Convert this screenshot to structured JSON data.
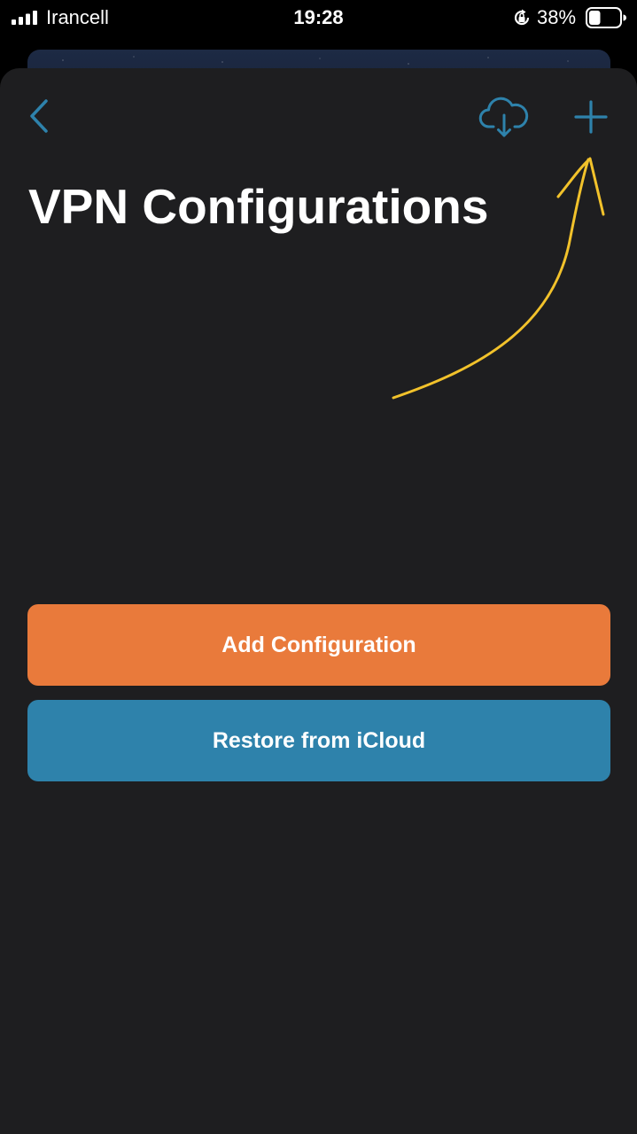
{
  "status_bar": {
    "carrier": "Irancell",
    "time": "19:28",
    "battery_percent": "38%",
    "signal_bars": 4,
    "battery_level": 0.38
  },
  "nav": {
    "back_icon": "chevron-left-icon",
    "cloud_icon": "cloud-download-icon",
    "add_icon": "plus-icon"
  },
  "page": {
    "title": "VPN Configurations"
  },
  "actions": {
    "add_label": "Add Configuration",
    "restore_label": "Restore from iCloud"
  },
  "colors": {
    "sheet_background": "#1e1e20",
    "accent_blue": "#2e82ab",
    "accent_orange": "#e97a3b",
    "annotation_yellow": "#f2c22b"
  }
}
